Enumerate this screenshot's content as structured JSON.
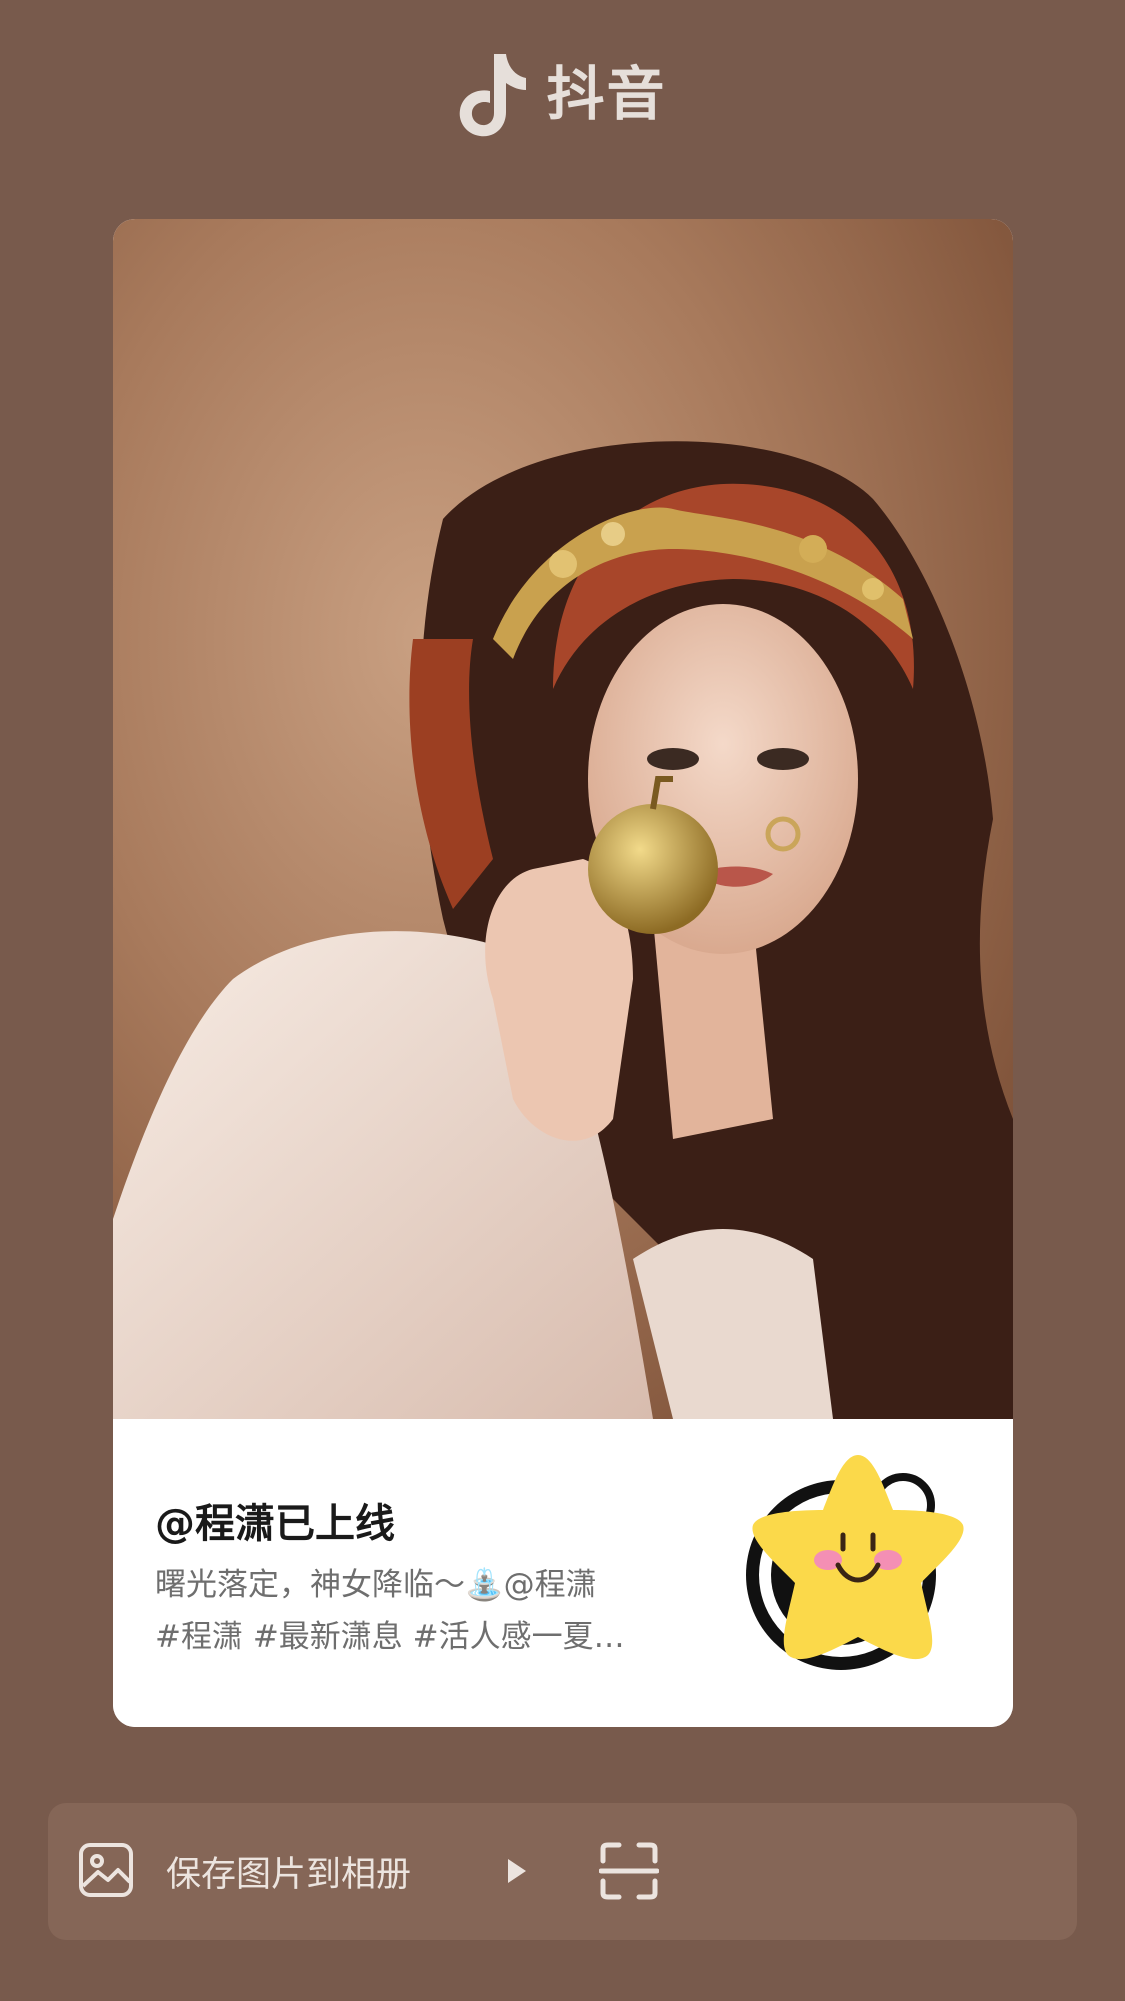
{
  "app": {
    "name": "抖音",
    "logo_icon": "douyin-note-icon"
  },
  "card": {
    "username": "@程潇已上线",
    "description_lines": [
      "曙光落定，神女降临～⛲@程潇",
      "#程潇 #最新潇息 #活人感一夏…"
    ],
    "qr_sticker_icon": "star-face-sticker-icon"
  },
  "action_bar": {
    "save_label": "保存图片到相册",
    "save_icon": "image-icon",
    "play_icon": "play-icon",
    "scan_icon": "scan-icon"
  },
  "colors": {
    "background": "#785a4c",
    "action_bar": "#856657",
    "card": "#ffffff",
    "sticker": "#fbd94a"
  }
}
